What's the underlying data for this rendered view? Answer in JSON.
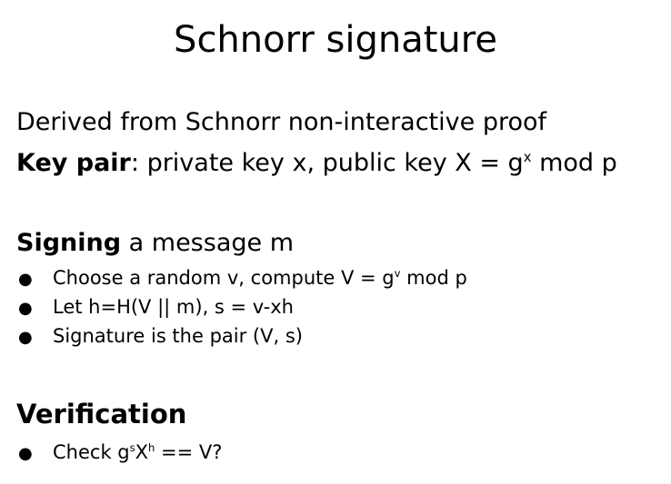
{
  "slide": {
    "title": "Schnorr signature",
    "intro": {
      "line1": "Derived from Schnorr non-interactive proof",
      "keypair_label": "Key pair",
      "keypair_text_a": ": private key x, public key X = g",
      "keypair_sup": "x",
      "keypair_text_b": " mod p"
    },
    "signing": {
      "label": "Signing",
      "rest": " a message m",
      "bullets": [
        {
          "text_a": "Choose a random v, compute V = g",
          "sup": "v",
          "text_b": " mod p"
        },
        {
          "text": "Let h=H(V || m), s = v-xh"
        },
        {
          "text": "Signature is the pair (V, s)"
        }
      ]
    },
    "verification": {
      "label": "Verification",
      "bullet": {
        "text_a": "Check g",
        "sup1": "s",
        "mid": "X",
        "sup2": "h",
        "text_b": " == V?"
      }
    },
    "bullet_glyph": "●"
  }
}
